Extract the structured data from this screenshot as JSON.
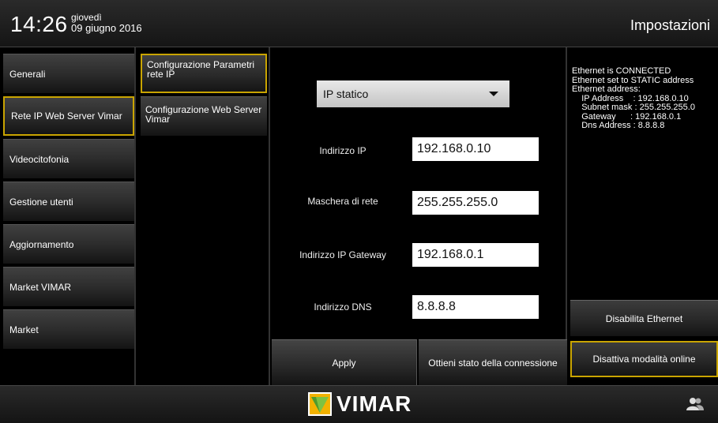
{
  "header": {
    "time": "14:26",
    "day": "giovedì",
    "date": "09 giugno 2016",
    "title": "Impostazioni"
  },
  "menu": [
    {
      "label": "Generali",
      "selected": false
    },
    {
      "label": "Rete IP Web Server Vimar",
      "selected": true
    },
    {
      "label": "Videocitofonia",
      "selected": false
    },
    {
      "label": "Gestione utenti",
      "selected": false
    },
    {
      "label": "Aggiornamento",
      "selected": false
    },
    {
      "label": "Market VIMAR",
      "selected": false
    },
    {
      "label": "Market",
      "selected": false
    }
  ],
  "submenu": [
    {
      "label": "Configurazione Parametri rete IP",
      "selected": true
    },
    {
      "label": "Configurazione Web Server Vimar",
      "selected": false
    }
  ],
  "form": {
    "mode": "IP statico",
    "fields": [
      {
        "label": "Indirizzo IP",
        "value": "192.168.0.10"
      },
      {
        "label": "Maschera di rete",
        "value": "255.255.255.0"
      },
      {
        "label": "Indirizzo IP Gateway",
        "value": "192.168.0.1"
      },
      {
        "label": "Indirizzo DNS",
        "value": "8.8.8.8"
      }
    ],
    "apply_label": "Apply",
    "status_label": "Ottieni stato della connessione"
  },
  "status": {
    "lines": [
      "Ethernet is CONNECTED",
      "Ethernet set to STATIC address",
      "Ethernet address:",
      "    IP Address    : 192.168.0.10",
      "    Subnet mask : 255.255.255.0",
      "    Gateway      : 192.168.0.1",
      "    Dns Address : 8.8.8.8"
    ],
    "disable_ethernet_label": "Disabilita Ethernet",
    "disable_online_label": "Disattiva modalità online"
  },
  "footer": {
    "brand": "VIMAR"
  },
  "colors": {
    "accent": "#c9a400"
  }
}
